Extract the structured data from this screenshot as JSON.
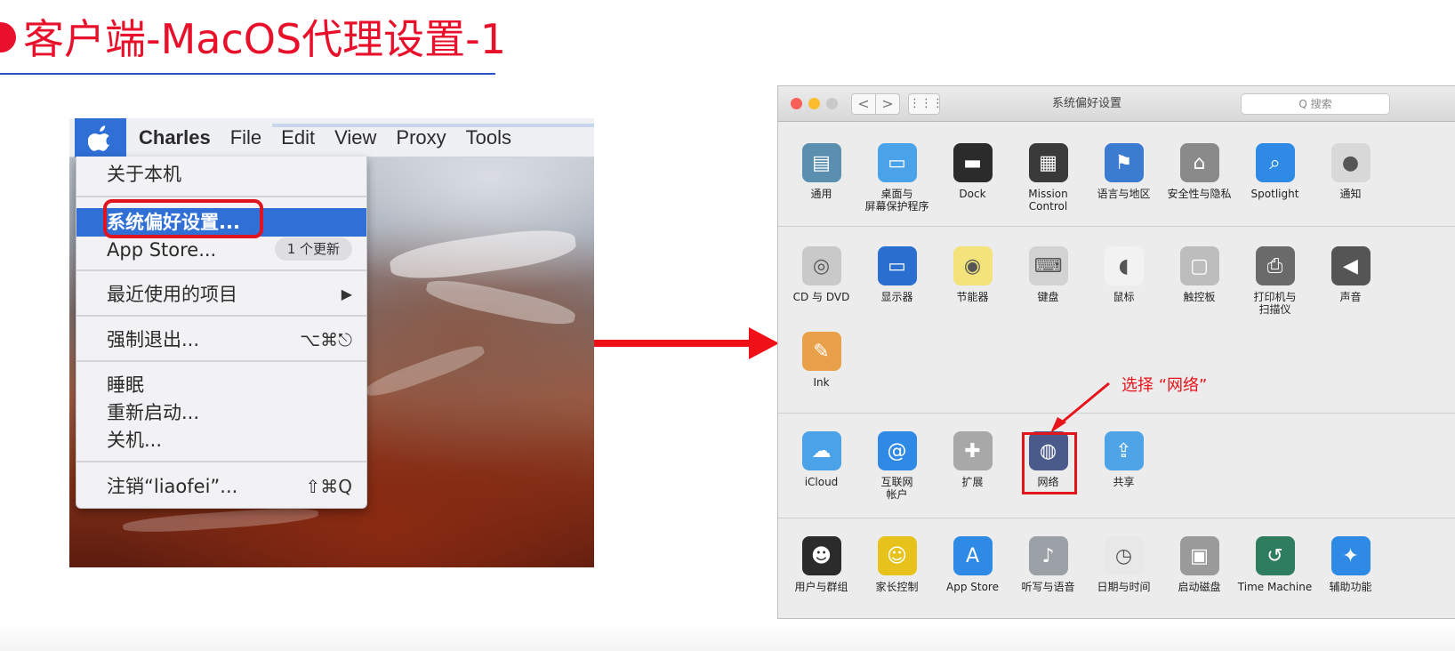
{
  "slide": {
    "title": "客户端-MacOS代理设置-1"
  },
  "menubar": {
    "items": [
      "Charles",
      "File",
      "Edit",
      "View",
      "Proxy",
      "Tools"
    ]
  },
  "apple_menu": {
    "about": "关于本机",
    "system_prefs": "系统偏好设置...",
    "app_store": "App Store...",
    "app_store_badge": "1 个更新",
    "recent": "最近使用的项目",
    "recent_arrow": "▶",
    "force_quit": "强制退出...",
    "force_quit_shortcut": "⌥⌘⎋",
    "sleep": "睡眠",
    "restart": "重新启动...",
    "shutdown": "关机...",
    "logout": "注销“liaofei”...",
    "logout_shortcut": "⇧⌘Q"
  },
  "prefs_window": {
    "title": "系统偏好设置",
    "search_placeholder": "Q 搜索",
    "nav_back": "<",
    "nav_forward": ">",
    "grid_label": "⋮⋮⋮",
    "row1": [
      {
        "label": "通用",
        "icon": "general-icon",
        "color": "#5a8fb0"
      },
      {
        "label": "桌面与\n屏幕保护程序",
        "icon": "desktop-icon",
        "color": "#4aa3e8"
      },
      {
        "label": "Dock",
        "icon": "dock-icon",
        "color": "#2b2b2b"
      },
      {
        "label": "Mission\nControl",
        "icon": "mission-control-icon",
        "color": "#3a3a3a"
      },
      {
        "label": "语言与地区",
        "icon": "language-icon",
        "color": "#3b7bd0"
      },
      {
        "label": "安全性与隐私",
        "icon": "security-icon",
        "color": "#8a8a8a"
      },
      {
        "label": "Spotlight",
        "icon": "spotlight-icon",
        "color": "#2f8ae6"
      },
      {
        "label": "通知",
        "icon": "notifications-icon",
        "color": "#d8d8d8"
      }
    ],
    "row2": [
      {
        "label": "CD 与 DVD",
        "icon": "cd-icon",
        "color": "#c9c9c9"
      },
      {
        "label": "显示器",
        "icon": "display-icon",
        "color": "#2a6fd0"
      },
      {
        "label": "节能器",
        "icon": "energy-icon",
        "color": "#f3e37a"
      },
      {
        "label": "键盘",
        "icon": "keyboard-icon",
        "color": "#d2d2d2"
      },
      {
        "label": "鼠标",
        "icon": "mouse-icon",
        "color": "#f2f2f2"
      },
      {
        "label": "触控板",
        "icon": "trackpad-icon",
        "color": "#bdbdbd"
      },
      {
        "label": "打印机与\n扫描仪",
        "icon": "printer-icon",
        "color": "#6a6a6a"
      },
      {
        "label": "声音",
        "icon": "sound-icon",
        "color": "#555555"
      }
    ],
    "row2b": [
      {
        "label": "Ink",
        "icon": "ink-icon",
        "color": "#e9a04a"
      }
    ],
    "row3": [
      {
        "label": "iCloud",
        "icon": "icloud-icon",
        "color": "#4aa3e8"
      },
      {
        "label": "互联网\n帐户",
        "icon": "internet-accounts-icon",
        "color": "#2f8ae6"
      },
      {
        "label": "扩展",
        "icon": "extensions-icon",
        "color": "#a8a8a8"
      },
      {
        "label": "网络",
        "icon": "network-icon",
        "color": "#4a5a8a"
      },
      {
        "label": "共享",
        "icon": "sharing-icon",
        "color": "#4ea4e6"
      }
    ],
    "row4": [
      {
        "label": "用户与群组",
        "icon": "users-icon",
        "color": "#2b2b2b"
      },
      {
        "label": "家长控制",
        "icon": "parental-icon",
        "color": "#e6c21a"
      },
      {
        "label": "App Store",
        "icon": "appstore-icon",
        "color": "#2f8ae6"
      },
      {
        "label": "听写与语音",
        "icon": "dictation-icon",
        "color": "#9aa0a6"
      },
      {
        "label": "日期与时间",
        "icon": "datetime-icon",
        "color": "#e8e8e8"
      },
      {
        "label": "启动磁盘",
        "icon": "startup-disk-icon",
        "color": "#9a9a9a"
      },
      {
        "label": "Time Machine",
        "icon": "time-machine-icon",
        "color": "#2e7d5f"
      },
      {
        "label": "辅助功能",
        "icon": "accessibility-icon",
        "color": "#2f8ae6"
      }
    ]
  },
  "annotation": {
    "select_network": "选择 “网络”"
  },
  "colors": {
    "accent_red": "#e8102a",
    "highlight_blue": "#2f6fd6",
    "underline_blue": "#2a52c8"
  }
}
